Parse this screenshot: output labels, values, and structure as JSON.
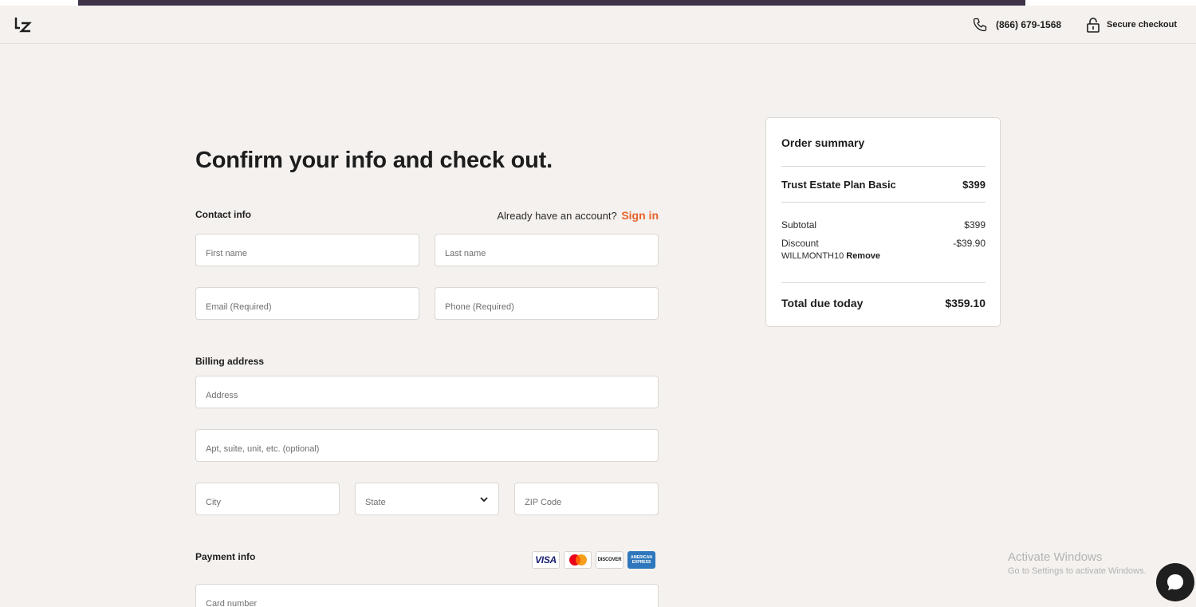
{
  "header": {
    "phone_number": "(866) 679-1568",
    "secure_label": "Secure checkout"
  },
  "page": {
    "title": "Confirm your info and check out."
  },
  "contact": {
    "label": "Contact info",
    "account_prompt": "Already have an account?",
    "signin_label": "Sign in",
    "first_name_placeholder": "First name",
    "last_name_placeholder": "Last name",
    "email_placeholder": "Email (Required)",
    "phone_placeholder": "Phone (Required)"
  },
  "billing": {
    "label": "Billing address",
    "address_placeholder": "Address",
    "apt_placeholder": "Apt, suite, unit, etc. (optional)",
    "city_placeholder": "City",
    "state_placeholder": "State",
    "zip_placeholder": "ZIP Code"
  },
  "payment": {
    "label": "Payment info",
    "cards": {
      "visa": "VISA",
      "discover": "DISCOVER",
      "amex": "AMERICAN EXPRESS"
    },
    "card_number_placeholder": "Card number"
  },
  "summary": {
    "title": "Order summary",
    "item_name": "Trust Estate Plan Basic",
    "item_price": "$399",
    "subtotal_label": "Subtotal",
    "subtotal_value": "$399",
    "discount_label": "Discount",
    "discount_value": "-$39.90",
    "discount_code": "WILLMONTH10",
    "remove_label": "Remove",
    "total_label": "Total due today",
    "total_value": "$359.10"
  },
  "os_overlay": {
    "activate_title": "Activate Windows",
    "activate_sub": "Go to Settings to activate Windows."
  },
  "colors": {
    "accent": "#e8622c",
    "background": "#f4f1ee",
    "top_bar": "#3e3348"
  }
}
